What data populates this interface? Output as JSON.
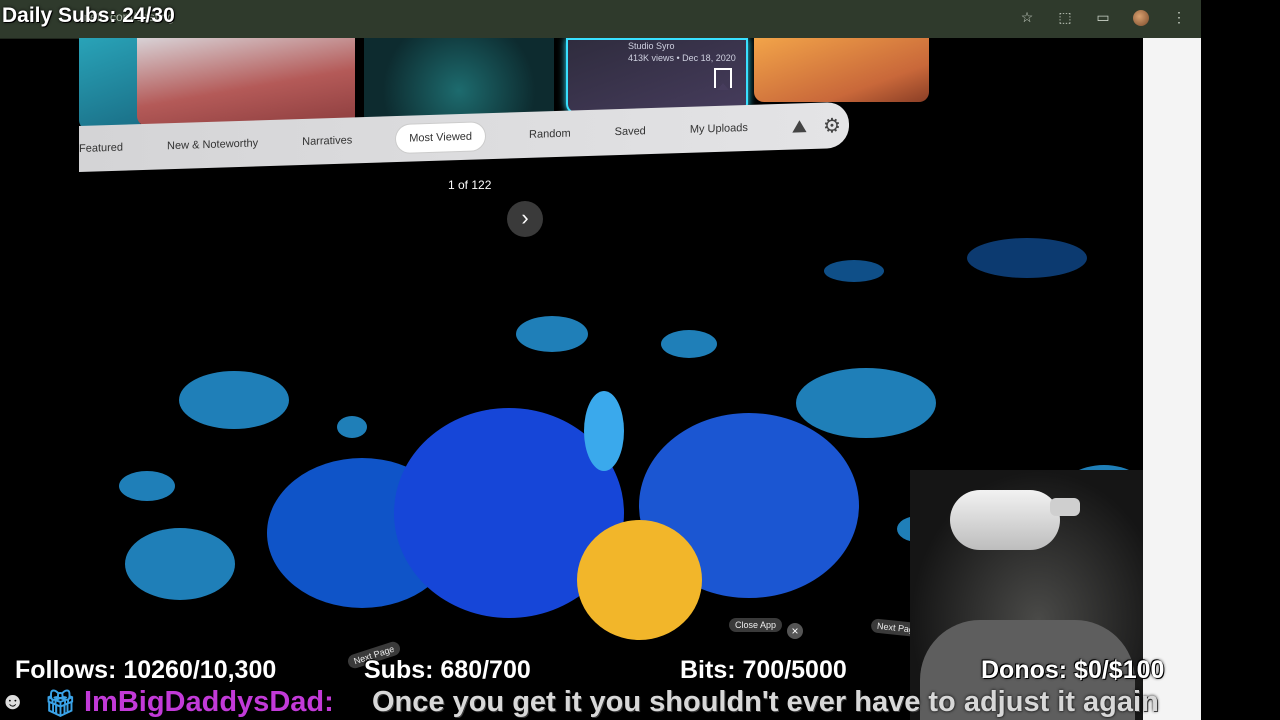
{
  "overlay": {
    "daily_subs": "Daily Subs: 24/30",
    "follows": "Follows: 10260/10,300",
    "subs": "Subs: 680/700",
    "bits": "Bits: 700/5000",
    "donos": "Donos: $0/$100"
  },
  "chat": {
    "user": "ImBigDaddysDad:",
    "message": "Once you get it you shouldn't ever have to adjust it again"
  },
  "browser": {
    "url_text": "meta.com/casting",
    "icons": [
      "star-icon",
      "extension-icon",
      "tab-icon",
      "avatar",
      "menu-icon"
    ]
  },
  "vr": {
    "thumb_meta": {
      "author": "Studio Syro",
      "stats": "413K views  •  Dec 18, 2020"
    },
    "tabs": [
      "Featured",
      "New & Noteworthy",
      "Narratives",
      "Most Viewed",
      "Random",
      "Saved",
      "My Uploads"
    ],
    "active_tab": "Most Viewed",
    "page_count": "1 of 122",
    "bottom_labels": {
      "next_page_left": "Next Page",
      "close_app": "Close App",
      "next_page_right": "Next Page"
    }
  },
  "colors": {
    "accent_cyan": "#39e0ff",
    "blob_blue": "#1f7fb8",
    "chat_user": "#c23ad8"
  }
}
